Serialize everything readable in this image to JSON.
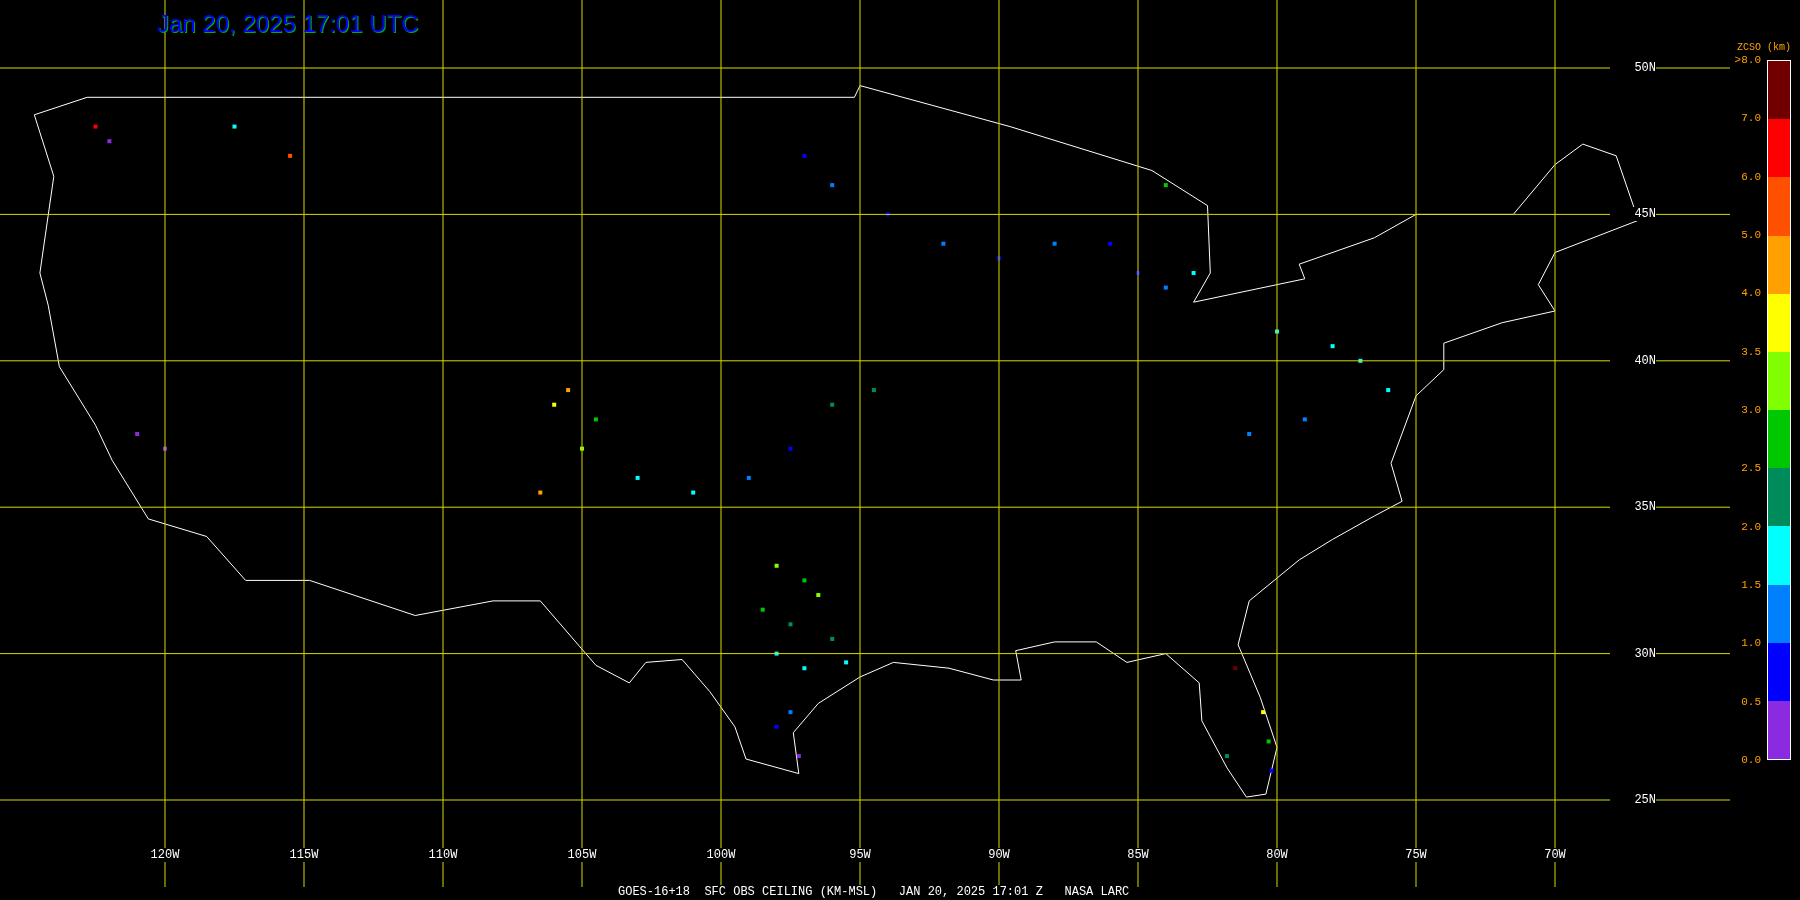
{
  "title": "Jan 20, 2025 17:01 UTC",
  "map": {
    "latitude_labels": [
      "50N",
      "45N",
      "40N",
      "35N",
      "30N",
      "25N"
    ],
    "longitude_labels": [
      "120W",
      "115W",
      "110W",
      "105W",
      "100W",
      "95W",
      "90W",
      "85W",
      "80W",
      "75W",
      "70W"
    ]
  },
  "legend": {
    "title": "ZCSO (km)",
    "labels": [
      ">8.0",
      "7.0",
      "6.0",
      "5.0",
      "4.0",
      "3.5",
      "3.0",
      "2.5",
      "2.0",
      "1.5",
      "1.0",
      "0.5",
      "0.0"
    ],
    "bins": [
      {
        "color": "#700000"
      },
      {
        "color": "#ff0000"
      },
      {
        "color": "#ff5000"
      },
      {
        "color": "#ffa000"
      },
      {
        "color": "#ffff00"
      },
      {
        "color": "#80ff00"
      },
      {
        "color": "#00c800"
      },
      {
        "color": "#008c5a"
      },
      {
        "color": "#00ffff"
      },
      {
        "color": "#0080ff"
      },
      {
        "color": "#0000ff"
      },
      {
        "color": "#8a2be2"
      }
    ]
  },
  "caption": "GOES-16+18  SFC OBS CEILING (KM-MSL)   JAN 20, 2025 17:01 Z   NASA LARC"
}
